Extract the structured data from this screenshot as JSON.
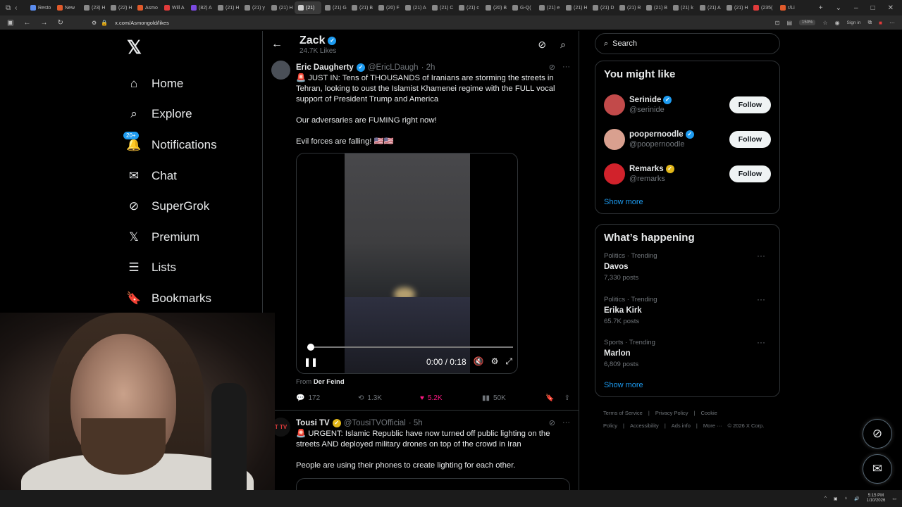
{
  "browser": {
    "tabs": [
      {
        "label": "Resto",
        "fav": "#5b8def"
      },
      {
        "label": "New",
        "fav": "#e05a2b"
      },
      {
        "label": "(23) H",
        "fav": "#888"
      },
      {
        "label": "(22) H",
        "fav": "#888"
      },
      {
        "label": "Asmo",
        "fav": "#e05a2b"
      },
      {
        "label": "Will A",
        "fav": "#e03b3b"
      },
      {
        "label": "(82) A",
        "fav": "#7b4ae0"
      },
      {
        "label": "(21) H",
        "fav": "#888"
      },
      {
        "label": "(21) y",
        "fav": "#888"
      },
      {
        "label": "(21) H",
        "fav": "#888"
      },
      {
        "label": "(21)",
        "fav": "#ccc",
        "active": true
      },
      {
        "label": "(21) G",
        "fav": "#888"
      },
      {
        "label": "(21) B",
        "fav": "#888"
      },
      {
        "label": "(20) F",
        "fav": "#888"
      },
      {
        "label": "(21) A",
        "fav": "#888"
      },
      {
        "label": "(21) C",
        "fav": "#888"
      },
      {
        "label": "(21) c",
        "fav": "#888"
      },
      {
        "label": "(20) B",
        "fav": "#888"
      },
      {
        "label": "G-Q(",
        "fav": "#888"
      },
      {
        "label": "(21) e",
        "fav": "#888"
      },
      {
        "label": "(21) H",
        "fav": "#888"
      },
      {
        "label": "(21) D",
        "fav": "#888"
      },
      {
        "label": "(21) R",
        "fav": "#888"
      },
      {
        "label": "(21) B",
        "fav": "#888"
      },
      {
        "label": "(21) k",
        "fav": "#888"
      },
      {
        "label": "(21) A",
        "fav": "#888"
      },
      {
        "label": "(21) H",
        "fav": "#888"
      },
      {
        "label": "(235(",
        "fav": "#e03b3b"
      },
      {
        "label": "r/Li",
        "fav": "#e05a2b"
      }
    ],
    "url": "x.com/Asmongold/likes",
    "zoom": "150%",
    "signin_label": "Sign in"
  },
  "nav": {
    "items": [
      {
        "label": "Home",
        "icon": "home-icon",
        "glyph": "⌂"
      },
      {
        "label": "Explore",
        "icon": "search-icon",
        "glyph": "⌕"
      },
      {
        "label": "Notifications",
        "icon": "bell-icon",
        "glyph": "🔔",
        "badge": "20+"
      },
      {
        "label": "Chat",
        "icon": "mail-icon",
        "glyph": "✉"
      },
      {
        "label": "SuperGrok",
        "icon": "grok-icon",
        "glyph": "⊘"
      },
      {
        "label": "Premium",
        "icon": "x-premium-icon",
        "glyph": "𝕏"
      },
      {
        "label": "Lists",
        "icon": "list-icon",
        "glyph": "☰"
      },
      {
        "label": "Bookmarks",
        "icon": "bookmark-icon",
        "glyph": "🔖"
      }
    ],
    "logo": "𝕏"
  },
  "profile": {
    "name": "Zack",
    "likes": "24.7K Likes"
  },
  "tweets": [
    {
      "name": "Eric Daugherty",
      "handle": "@EricLDaugh",
      "time": "· 2h",
      "avatar_color": "#4a4f57",
      "text": "🚨 JUST IN: Tens of THOUSANDS of Iranians are storming the streets in Tehran, looking to oust the Islamist Khamenei regime with the FULL vocal support of President Trump and America\n\nOur adversaries are FUMING right now!\n\nEvil forces are falling! 🇺🇸🇺🇸",
      "video_time": "0:00 / 0:18",
      "video_progress": 0,
      "from_label": "From",
      "from_source": "Der Feind",
      "replies": "172",
      "reposts": "1.3K",
      "likes": "5.2K",
      "views": "50K"
    },
    {
      "name": "Tousi TV",
      "handle": "@TousiTVOfficial",
      "time": "· 5h",
      "avatar_color": "#111",
      "avatar_text": "T TV",
      "text": "🚨 URGENT: Islamic Republic have now turned off public lighting on the streets AND deployed military drones on top of the crowd in Iran\n\nPeople are using their phones to create lighting for each other."
    }
  ],
  "search": {
    "placeholder": "Search"
  },
  "suggestions": {
    "title": "You might like",
    "items": [
      {
        "name": "Serinide",
        "handle": "@serinide",
        "avatar_color": "#c24a4a",
        "badge": "blue"
      },
      {
        "name": "poopernoodle",
        "handle": "@poopernoodle",
        "avatar_color": "#d9a08f",
        "badge": "blue"
      },
      {
        "name": "Remarks",
        "handle": "@remarks",
        "avatar_color": "#d1222b",
        "badge": "gold"
      }
    ],
    "follow_label": "Follow",
    "show_more": "Show more"
  },
  "trends": {
    "title": "What’s happening",
    "items": [
      {
        "category": "Politics · Trending",
        "name": "Davos",
        "count": "7,330 posts"
      },
      {
        "category": "Politics · Trending",
        "name": "Erika Kirk",
        "count": "65.7K posts"
      },
      {
        "category": "Sports · Trending",
        "name": "Marlon",
        "count": "6,809 posts"
      }
    ],
    "show_more": "Show more"
  },
  "footer": {
    "links": [
      "Terms of Service",
      "|",
      "Privacy Policy",
      "|",
      "Cookie Policy",
      "|",
      "Accessibility",
      "|",
      "Ads info",
      "|",
      "More ···",
      "© 2026 X Corp."
    ]
  },
  "taskbar": {
    "time": "5:15 PM",
    "date": "1/10/2026"
  },
  "colors": {
    "accent": "#1d9bf0",
    "like": "#f91880",
    "verified_gold": "#e2b719"
  }
}
